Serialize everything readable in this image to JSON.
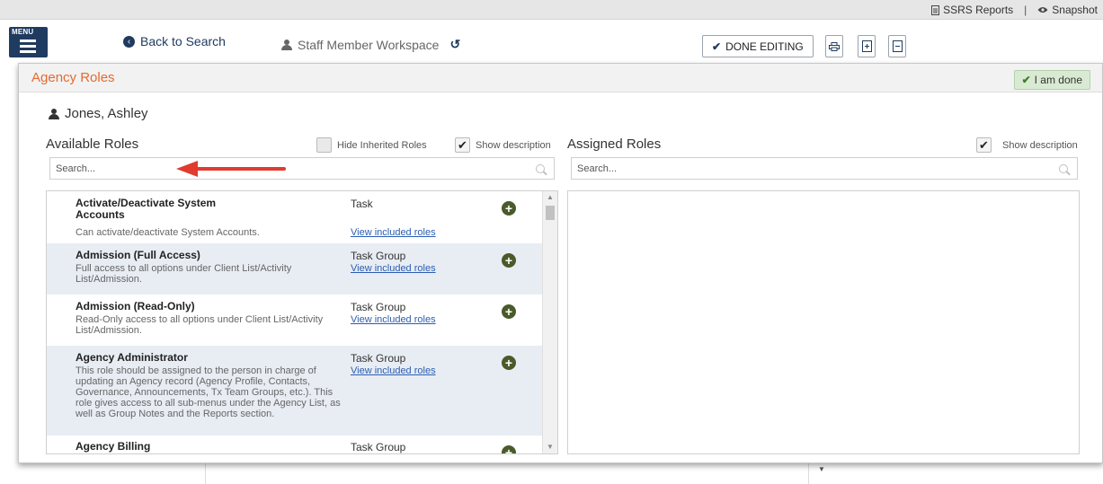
{
  "topbar": {
    "ssrs_label": "SSRS Reports",
    "separator": "|",
    "snapshot_label": "Snapshot"
  },
  "header": {
    "menu_label": "MENU",
    "back_label": "Back to Search",
    "workspace_label": "Staff Member Workspace",
    "done_editing_label": "DONE EDITING"
  },
  "modal": {
    "title": "Agency Roles",
    "done_label": "I am done",
    "person_name": "Jones, Ashley",
    "available": {
      "title": "Available Roles",
      "hide_inherited_label": "Hide Inherited Roles",
      "hide_inherited_checked": false,
      "show_description_label": "Show description",
      "show_description_checked": true,
      "search_placeholder": "Search...",
      "roles": [
        {
          "name": "Activate/Deactivate System Accounts",
          "description": "Can activate/deactivate System Accounts.",
          "type": "Task",
          "link": "View included roles"
        },
        {
          "name": "Admission (Full Access)",
          "description": "Full access to all options under Client List/Activity List/Admission.",
          "type": "Task Group",
          "link": "View included roles"
        },
        {
          "name": "Admission (Read-Only)",
          "description": "Read-Only access to all options under Client List/Activity List/Admission.",
          "type": "Task Group",
          "link": "View included roles"
        },
        {
          "name": "Agency Administrator",
          "description": "This role should be assigned to the person in charge of updating an Agency record (Agency Profile, Contacts, Governance, Announcements, Tx Team Groups, etc.). This role gives access to all sub-menus under the Agency List, as well as Group Notes and the Reports section.",
          "type": "Task Group",
          "link": "View included roles"
        },
        {
          "name": "Agency Billing",
          "description": "",
          "type": "Task Group",
          "link": ""
        }
      ]
    },
    "assigned": {
      "title": "Assigned Roles",
      "show_description_label": "Show description",
      "show_description_checked": true,
      "search_placeholder": "Search..."
    }
  },
  "colors": {
    "navy": "#1f3b60",
    "title_orange": "#e46a2f",
    "row_alt": "#e8edf4",
    "add_button": "#4a5a2a",
    "annotation_arrow": "#e03b2e",
    "done_button_bg": "#d9ead3"
  },
  "icons": {
    "ssrs": "document-icon",
    "snapshot": "eye-icon",
    "back": "arrow-left-circle-icon",
    "workspace": "user-icon",
    "refresh": "history-icon",
    "done_editing": "check-icon",
    "print": "print-icon",
    "expand": "expand-all-icon",
    "collapse": "collapse-all-icon",
    "add": "plus-circle-icon",
    "search": "search-icon"
  }
}
